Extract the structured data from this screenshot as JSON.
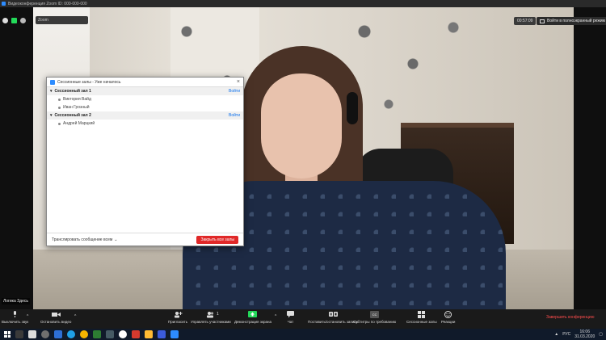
{
  "window": {
    "title": "Видеоконференция Zoom ID: 000-000-000"
  },
  "meeting": {
    "id_chip_text": "Zoom",
    "timer": "00:57:09",
    "fullscreen_label": "Войти в полноэкранный режим",
    "participant_name": "Логика Здесь"
  },
  "breakout_dialog": {
    "title": "Сессионные залы - Уже началось",
    "close_symbol": "×",
    "rooms": [
      {
        "name": "Сессионный зал 1",
        "join_label": "Войти",
        "members": [
          "Виктория Вайд",
          "Иван Грозный"
        ]
      },
      {
        "name": "Сессионный зал 2",
        "join_label": "Войти",
        "members": [
          "Андрей Марцкий"
        ]
      }
    ],
    "broadcast_label": "Транслировать сообщение всем",
    "broadcast_caret": "⌄",
    "close_all_label": "Закрыть все залы"
  },
  "toolbar": {
    "mute_label": "Выключить звук",
    "stop_video_label": "Остановить видео",
    "invite_label": "Пригласить",
    "participants_label": "Управлять участниками",
    "participants_count": "1",
    "share_label": "Демонстрация экрана",
    "chat_label": "Чат",
    "record_label": "Поставить/остановить запись",
    "captions_label": "Субтитры по требованию",
    "breakout_label": "Сессионные залы",
    "reactions_label": "Реакции",
    "end_label": "Завершить конференцию",
    "caret": "^",
    "captions_badge": "CC"
  },
  "taskbar": {
    "language": "РУС",
    "time": "16:06",
    "date": "31.03.2020"
  },
  "colors": {
    "zoom_blue": "#2d8cff",
    "end_red": "#ff4d4d",
    "close_all_red": "#e02828",
    "share_green": "#23d959"
  }
}
